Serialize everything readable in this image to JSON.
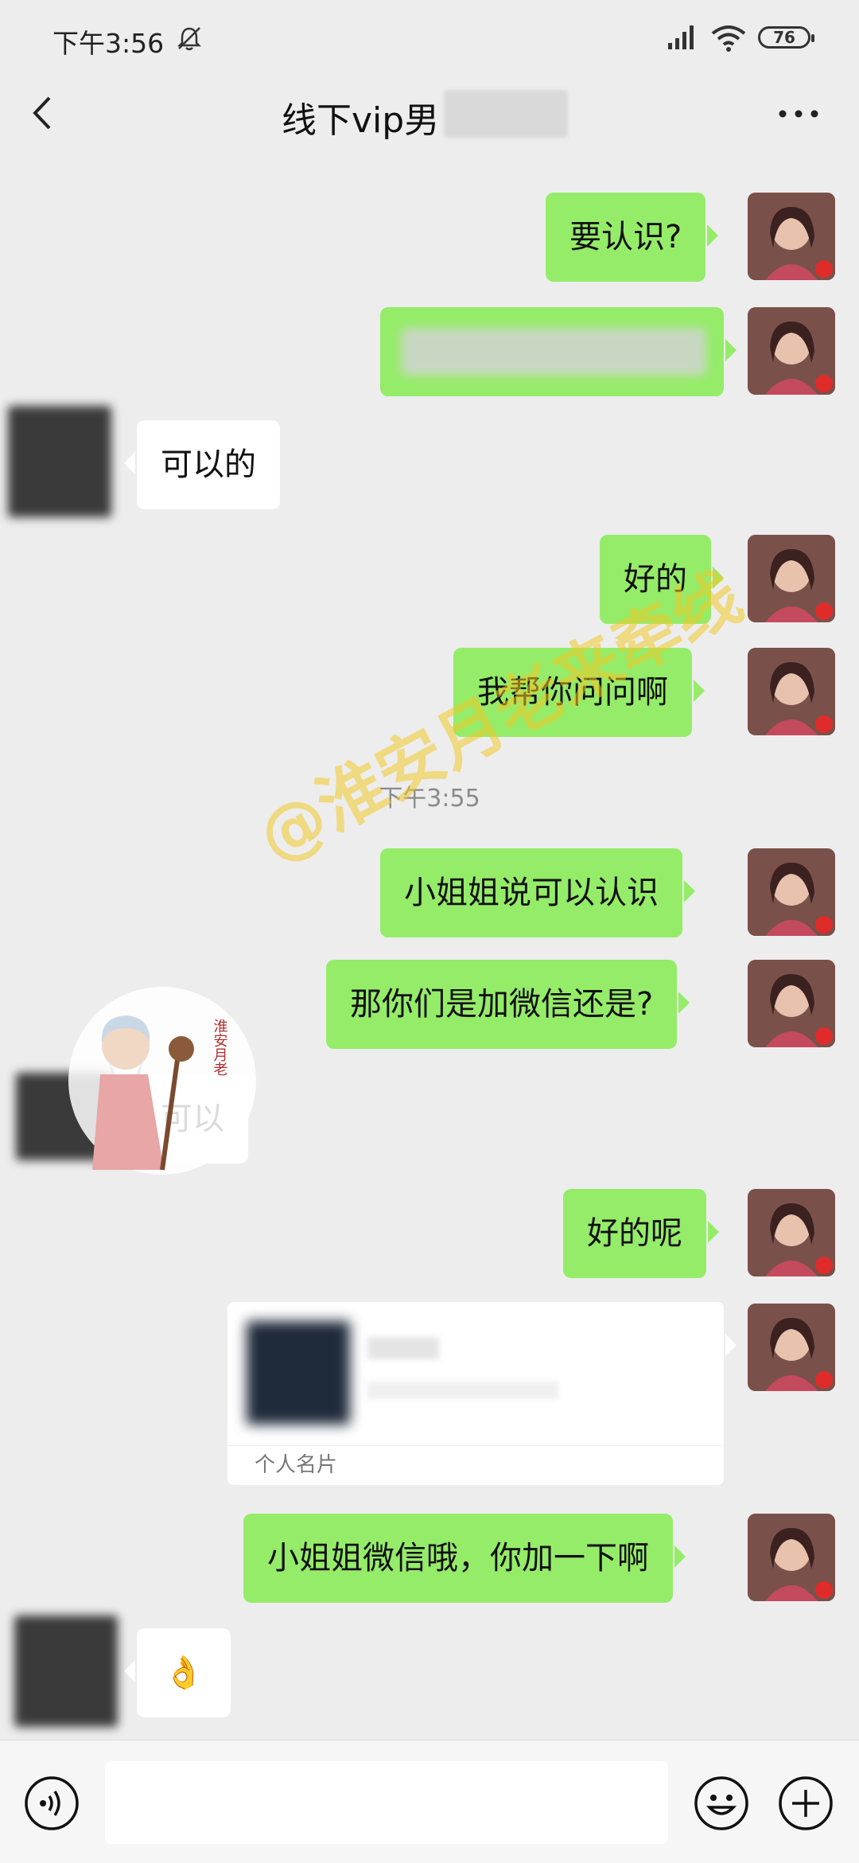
{
  "status_bar": {
    "time": "下午3:56",
    "battery": "76"
  },
  "header": {
    "title": "线下vip男"
  },
  "messages": [
    {
      "side": "right",
      "text": "要认识?"
    },
    {
      "side": "right",
      "text": ""
    },
    {
      "side": "left",
      "text": "可以的"
    },
    {
      "side": "right",
      "text": "好的"
    },
    {
      "side": "right",
      "text": "我帮你问问啊"
    },
    {
      "side": "right",
      "text": "小姐姐说可以认识"
    },
    {
      "side": "right",
      "text": "那你们是加微信还是?"
    },
    {
      "side": "left",
      "text": "可以"
    },
    {
      "side": "right",
      "text": "好的呢"
    },
    {
      "side": "right",
      "text": "小姐姐微信哦，你加一下啊"
    },
    {
      "side": "left",
      "text": "👌"
    }
  ],
  "timestamp": "下午3:55",
  "card": {
    "label": "个人名片"
  },
  "watermark": "@淮安月老来牵线",
  "seal_text": "淮安月老",
  "colors": {
    "my_bubble": "#95ec69",
    "their_bubble": "#ffffff",
    "background": "#ededed"
  }
}
